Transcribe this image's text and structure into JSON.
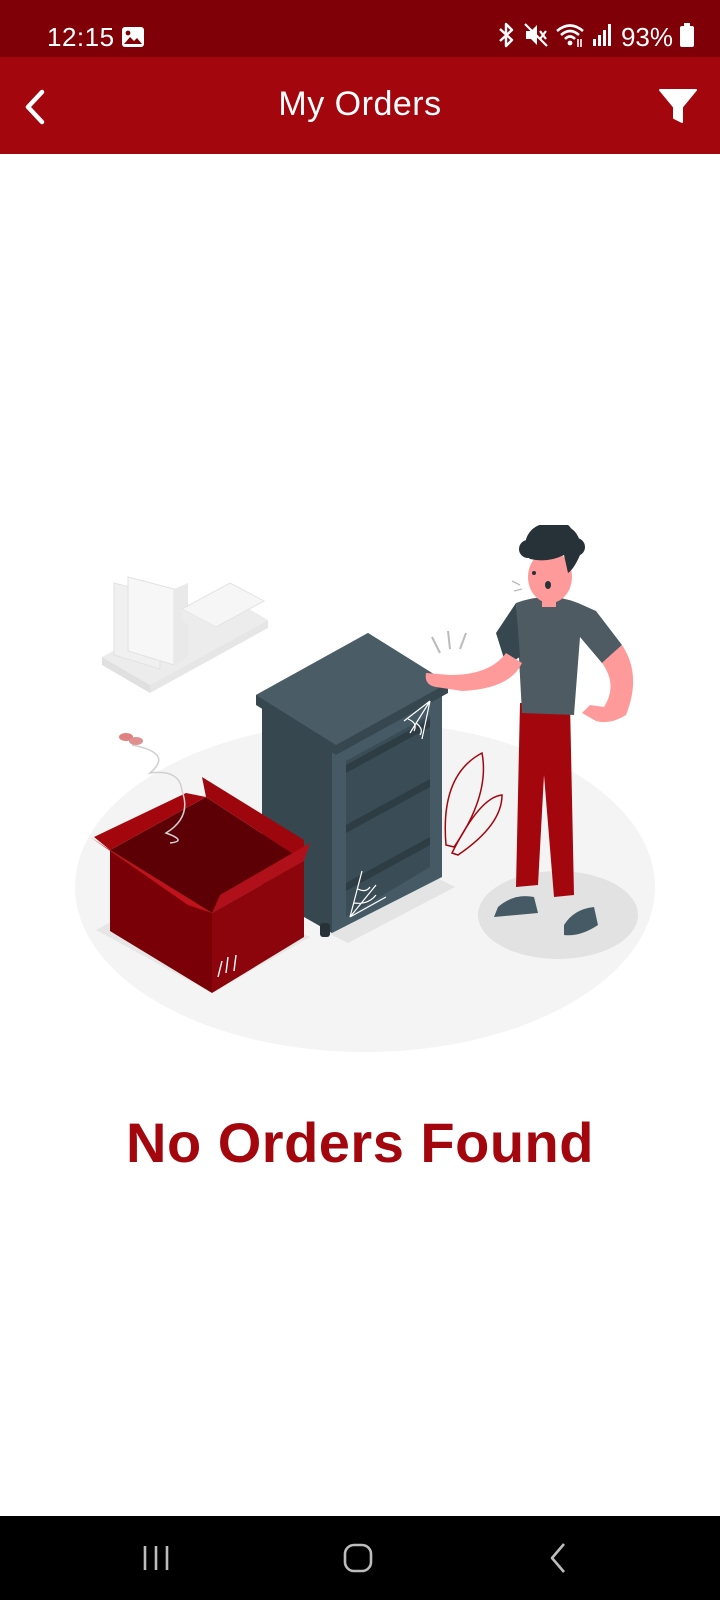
{
  "status_bar": {
    "time": "12:15",
    "battery": "93%",
    "icons": [
      "gallery-icon",
      "bluetooth-icon",
      "mute-icon",
      "wifi-icon",
      "signal-icon",
      "battery-icon"
    ]
  },
  "header": {
    "title": "My Orders",
    "back_icon": "back-arrow-icon",
    "filter_icon": "filter-icon"
  },
  "empty_state": {
    "message": "No Orders Found",
    "illustration": "empty-shelf-person-illustration"
  },
  "nav_bar": {
    "icons": [
      "recent-apps-icon",
      "home-icon",
      "back-icon"
    ]
  },
  "colors": {
    "status_bar": "#800008",
    "app_bar": "#a4060e",
    "accent": "#a4060e",
    "nav_bar": "#000000"
  }
}
